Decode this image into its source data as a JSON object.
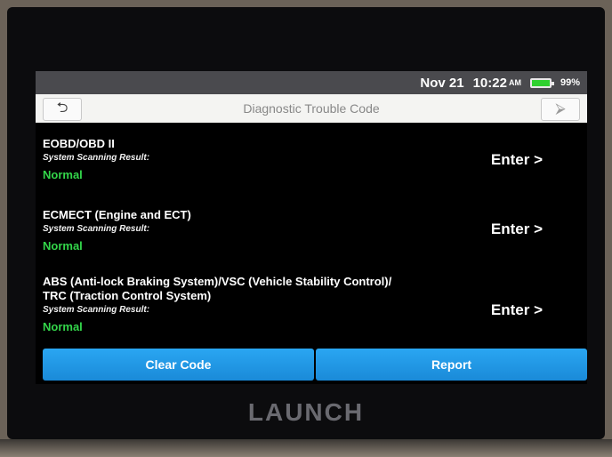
{
  "status": {
    "date": "Nov 21",
    "time": "10:22",
    "ampm": "AM",
    "battery": "99%"
  },
  "toolbar": {
    "title": "Diagnostic Trouble Code",
    "back_icon": "back-icon",
    "exit_icon": "exit-icon"
  },
  "systems": [
    {
      "name": "EOBD/OBD II",
      "label": "System Scanning Result:",
      "result": "Normal",
      "enter": "Enter >"
    },
    {
      "name": "ECMECT (Engine and ECT)",
      "label": "System Scanning Result:",
      "result": "Normal",
      "enter": "Enter >"
    },
    {
      "name": "ABS (Anti-lock Braking System)/VSC (Vehicle Stability Control)/",
      "name2": "TRC (Traction Control System)",
      "label": "System Scanning Result:",
      "result": "Normal",
      "enter": "Enter >"
    }
  ],
  "footer": {
    "clear": "Clear Code",
    "report": "Report"
  },
  "brand": "LAUNCH",
  "colors": {
    "accent": "#1a8ad8",
    "normal": "#33d64a",
    "battery": "#2fd12f"
  }
}
